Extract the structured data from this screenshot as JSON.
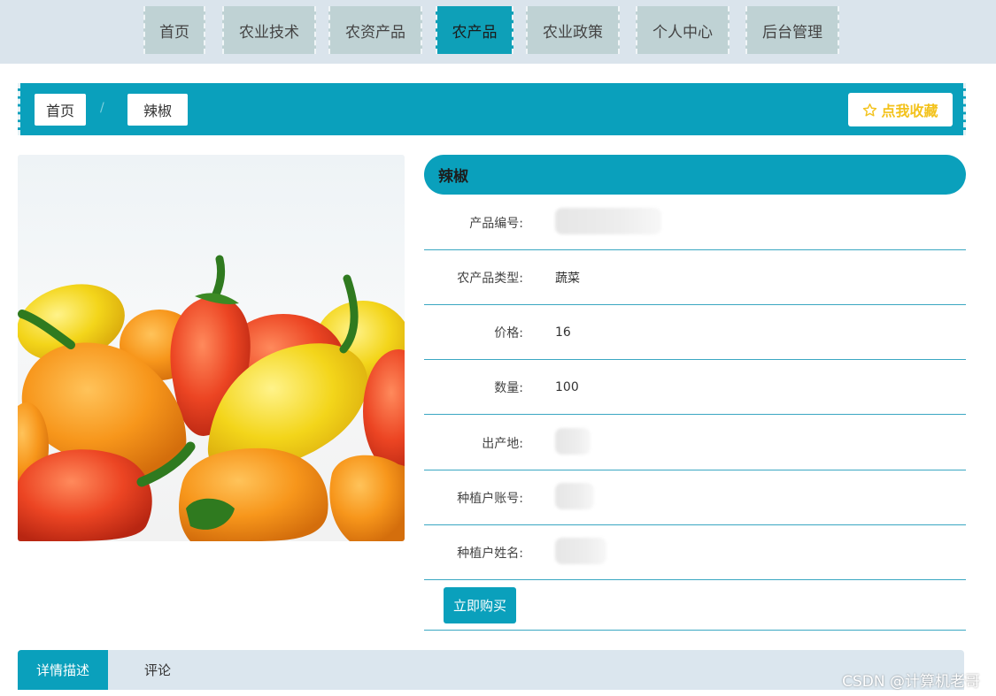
{
  "nav": {
    "items": [
      {
        "label": "首页"
      },
      {
        "label": "农业技术"
      },
      {
        "label": "农资产品"
      },
      {
        "label": "农产品"
      },
      {
        "label": "农业政策"
      },
      {
        "label": "个人中心"
      },
      {
        "label": "后台管理"
      }
    ],
    "active": "农产品"
  },
  "breadcrumb": {
    "home": "首页",
    "separator": "/",
    "current": "辣椒"
  },
  "favorite": {
    "label": "点我收藏",
    "icon": "star-outline-icon"
  },
  "product": {
    "name": "辣椒",
    "image": "chili-peppers-photo",
    "fields": [
      {
        "label": "产品编号:",
        "value": ""
      },
      {
        "label": "农产品类型:",
        "value": "蔬菜"
      },
      {
        "label": "价格:",
        "value": "16"
      },
      {
        "label": "数量:",
        "value": "100"
      },
      {
        "label": "出产地:",
        "value": ""
      },
      {
        "label": "种植户账号:",
        "value": ""
      },
      {
        "label": "种植户姓名:",
        "value": ""
      }
    ],
    "buy_label": "立即购买"
  },
  "tabs": [
    {
      "label": "详情描述",
      "active": true
    },
    {
      "label": "评论",
      "active": false
    }
  ],
  "watermark": "CSDN @计算机老哥",
  "colors": {
    "accent": "#0aa0bc",
    "nav_bg": "#dae4ec",
    "nav_item": "#bfd2d4",
    "favorite": "#f3c21b"
  }
}
